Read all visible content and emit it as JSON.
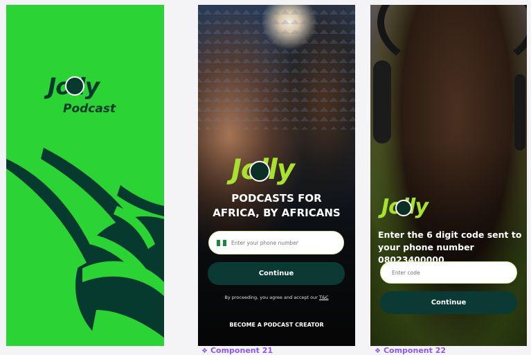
{
  "splash": {
    "brand": "Jolly",
    "sub": "Podcast",
    "bg": "#2bd334",
    "ink": "#063a2e"
  },
  "signup": {
    "brand": "Jolly",
    "tagline_1": "PODCASTS FOR",
    "tagline_2": "AFRICA, BY AFRICANS",
    "phone_placeholder": "Enter your phone number",
    "continue": "Continue",
    "terms_prefix": "By proceeding, you agree and accept our",
    "terms_link": "T&C",
    "creator": "BECOME A PODCAST CREATOR",
    "flag_icon": "nigeria-flag-icon",
    "accent": "#a8e22f",
    "button_bg": "#0a3a33"
  },
  "verify": {
    "brand": "Jolly",
    "instruction": "Enter the 6 digit code sent to your phone number 08023400000",
    "code_placeholder": "Enter code",
    "continue": "Continue"
  },
  "captions": {
    "c21": "Component 21",
    "c22": "Component 22",
    "icon": "component-icon",
    "color": "#8a55f0"
  }
}
